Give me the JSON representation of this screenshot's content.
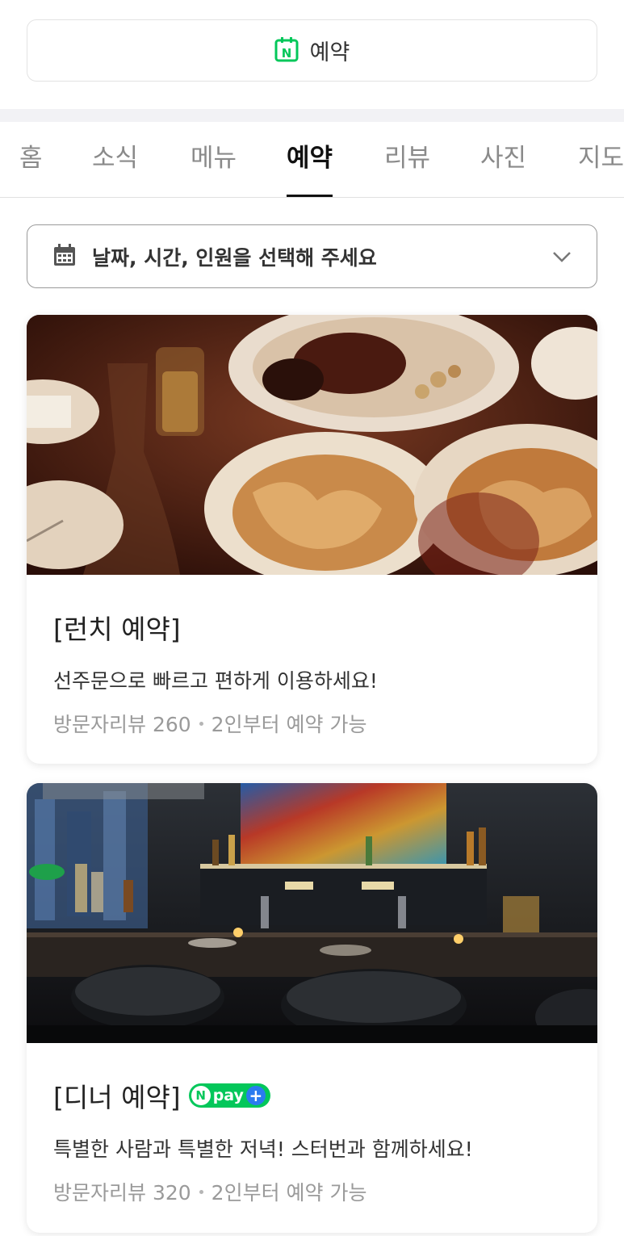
{
  "header": {
    "reserve_button_label": "예약",
    "reserve_icon_letter": "N"
  },
  "tabs": [
    {
      "label": "홈",
      "active": false
    },
    {
      "label": "소식",
      "active": false
    },
    {
      "label": "메뉴",
      "active": false
    },
    {
      "label": "예약",
      "active": true
    },
    {
      "label": "리뷰",
      "active": false
    },
    {
      "label": "사진",
      "active": false
    },
    {
      "label": "지도",
      "active": false
    }
  ],
  "date_picker": {
    "placeholder": "날짜, 시간, 인원을 선택해 주세요"
  },
  "cards": [
    {
      "title": "[런치 예약]",
      "description": "선주문으로 빠르고 편하게 이용하세요!",
      "review_label": "방문자리뷰 260",
      "capacity": "2인부터 예약 가능"
    },
    {
      "title": "[디너 예약]",
      "badge": "pay",
      "badge_n": "N",
      "badge_plus": "+",
      "description": "특별한 사람과 특별한 저녁! 스터번과 함께하세요!",
      "review_label": "방문자리뷰 320",
      "capacity": "2인부터 예약 가능"
    }
  ],
  "colors": {
    "brand_green": "#03c75a",
    "npay_plus_blue": "#2a7bef",
    "active_tab": "#111111",
    "inactive_tab": "#8a8a8a"
  }
}
